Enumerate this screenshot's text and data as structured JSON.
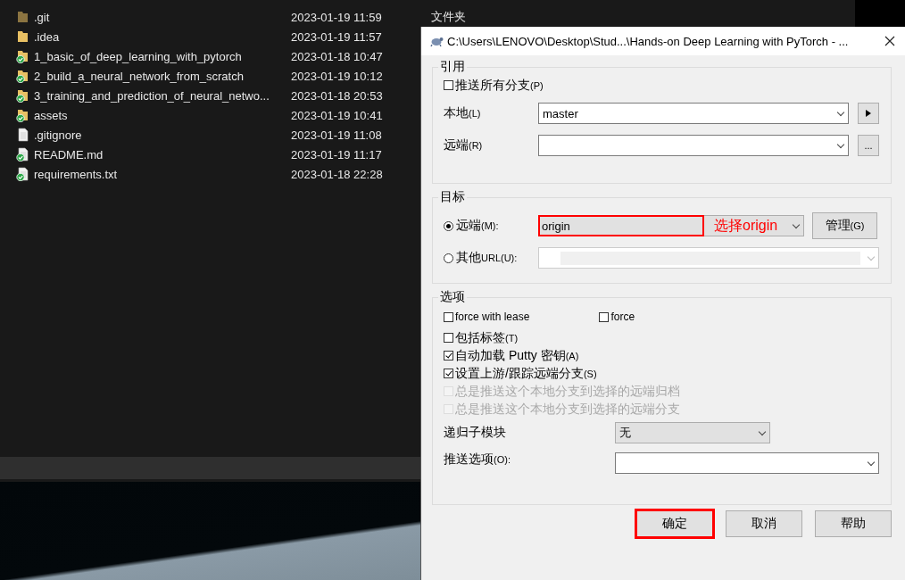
{
  "explorer": {
    "rows": [
      {
        "name": ".git",
        "modified": "2023-01-19 11:59",
        "type": "文件夹",
        "kind": "folder",
        "synced": false,
        "hidden": true
      },
      {
        "name": ".idea",
        "modified": "2023-01-19 11:57",
        "kind": "folder",
        "synced": false,
        "hidden": false
      },
      {
        "name": "1_basic_of_deep_learning_with_pytorch",
        "modified": "2023-01-18 10:47",
        "kind": "folder",
        "synced": true,
        "hidden": false
      },
      {
        "name": "2_build_a_neural_network_from_scratch",
        "modified": "2023-01-19 10:12",
        "kind": "folder",
        "synced": true,
        "hidden": false
      },
      {
        "name": "3_training_and_prediction_of_neural_netwo...",
        "modified": "2023-01-18 20:53",
        "kind": "folder",
        "synced": true,
        "hidden": false
      },
      {
        "name": "assets",
        "modified": "2023-01-19 10:41",
        "kind": "folder",
        "synced": true,
        "hidden": false
      },
      {
        "name": ".gitignore",
        "modified": "2023-01-19 11:08",
        "kind": "file",
        "synced": false,
        "hidden": false
      },
      {
        "name": "README.md",
        "modified": "2023-01-19 11:17",
        "kind": "file",
        "synced": true,
        "hidden": false
      },
      {
        "name": "requirements.txt",
        "modified": "2023-01-18 22:28",
        "kind": "file",
        "synced": true,
        "hidden": false
      }
    ]
  },
  "dialog": {
    "title": "C:\\Users\\LENOVO\\Desktop\\Stud...\\Hands-on Deep Learning with PyTorch - ...",
    "ref": {
      "title": "引用",
      "push_all": {
        "label": "推送所有分支",
        "key": "(P)",
        "checked": false
      },
      "local": {
        "label": "本地",
        "key": "(L)",
        "value": "master"
      },
      "remote": {
        "label": "远端",
        "key": "(R)"
      },
      "browse_button": {
        "label": "..."
      }
    },
    "target": {
      "title": "目标",
      "remote": {
        "label": "远端",
        "key": "(M):",
        "selected": true,
        "value": "origin",
        "highlighted": true,
        "note": "选择origin"
      },
      "manage_button": {
        "label": "管理",
        "key": "(G)"
      },
      "other_url": {
        "label": "其他",
        "key": "URL(U):",
        "selected": false
      }
    },
    "options": {
      "title": "选项",
      "checkboxes": [
        {
          "label": "force with lease",
          "checked": false,
          "disabled": false
        },
        {
          "label": "force",
          "checked": false,
          "disabled": false
        },
        {
          "label": "包括标签",
          "key": "(T)",
          "checked": false,
          "disabled": false
        },
        {
          "label": "自动加载 Putty 密钥",
          "key": "(A)",
          "checked": true,
          "disabled": false
        },
        {
          "label": "设置上游/跟踪远端分支",
          "key": "(S)",
          "checked": true,
          "disabled": false
        },
        {
          "label": "总是推送这个本地分支到选择的远端归档",
          "checked": false,
          "disabled": true
        },
        {
          "label": "总是推送这个本地分支到选择的远端分支",
          "checked": false,
          "disabled": true
        }
      ],
      "submodules": {
        "label": "递归子模块",
        "value": "无"
      },
      "push_options": {
        "label": "推送选项",
        "key": "(O):"
      }
    },
    "buttons": [
      {
        "label": "确定",
        "highlighted": true
      },
      {
        "label": "取消",
        "highlighted": false
      },
      {
        "label": "帮助",
        "highlighted": false
      }
    ]
  }
}
